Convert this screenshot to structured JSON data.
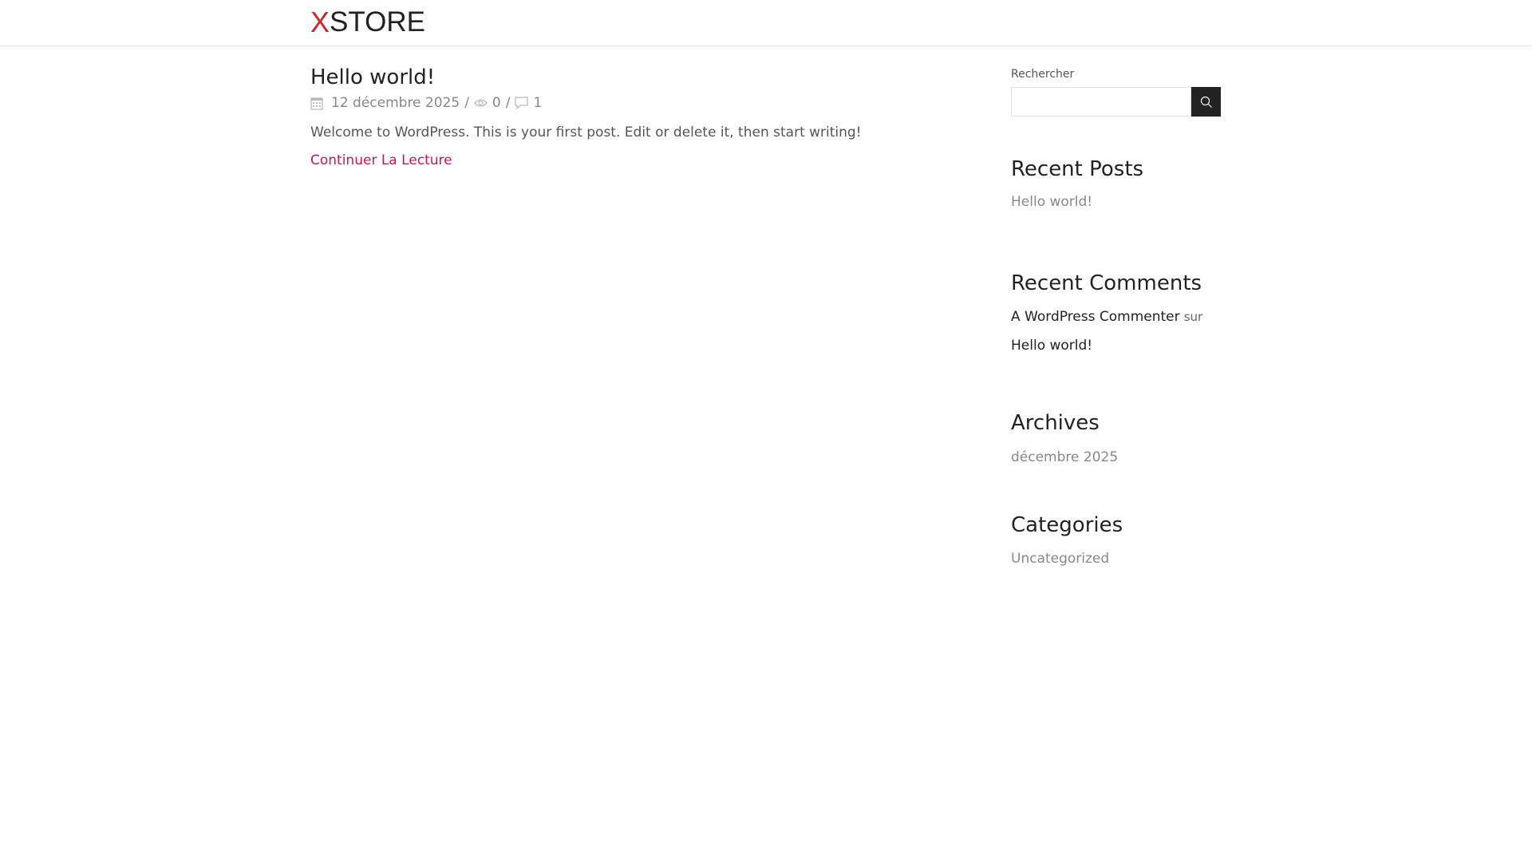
{
  "header": {
    "logo_mark": "X",
    "logo_text": "STORE"
  },
  "post": {
    "title": "Hello world!",
    "date": "12 décembre 2025",
    "separator": "/",
    "views": "0",
    "comments": "1",
    "excerpt": "Welcome to WordPress. This is your first post. Edit or delete it, then start writing!",
    "read_more": "Continuer La Lecture"
  },
  "sidebar": {
    "search": {
      "label": "Rechercher",
      "placeholder": ""
    },
    "recent_posts": {
      "title": "Recent Posts",
      "items": [
        "Hello world!"
      ]
    },
    "recent_comments": {
      "title": "Recent Comments",
      "author": "A WordPress Commenter",
      "on": "sur",
      "post": "Hello world!"
    },
    "archives": {
      "title": "Archives",
      "items": [
        "décembre 2025"
      ]
    },
    "categories": {
      "title": "Categories",
      "items": [
        "Uncategorized"
      ]
    }
  },
  "colors": {
    "accent": "#c2185b",
    "logo_red": "#c62828",
    "dark": "#222222"
  }
}
